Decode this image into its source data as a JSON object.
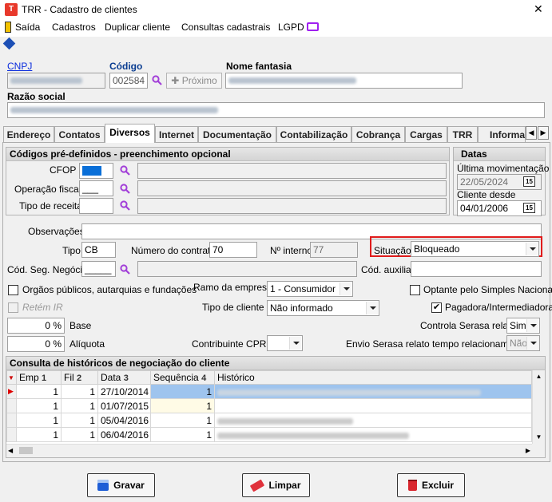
{
  "window": {
    "title": "TRR - Cadastro de clientes",
    "close_glyph": "✕"
  },
  "menu": {
    "saida": "Saída",
    "cadastros": "Cadastros",
    "duplicar": "Duplicar cliente",
    "consultas": "Consultas cadastrais",
    "lgpd": "LGPD"
  },
  "header": {
    "cnpj_label": "CNPJ",
    "codigo_label": "Código",
    "codigo_value": "002584",
    "proximo_label": "Próximo",
    "fantasia_label": "Nome fantasia",
    "razao_label": "Razão social"
  },
  "tabs": [
    "Endereço",
    "Contatos",
    "Diversos",
    "Internet",
    "Documentação",
    "Contabilização",
    "Cobrança",
    "Cargas",
    "TRR",
    "Informa"
  ],
  "codigos": {
    "title": "Códigos pré-definidos - preenchimento opcional",
    "cfop_label": "CFOP",
    "operacao_label": "Operação fiscal",
    "operacao_value": "___",
    "receita_label": "Tipo de receita"
  },
  "datas": {
    "title": "Datas",
    "ultima_label": "Última movimentação",
    "ultima_value": "22/05/2024",
    "cliente_desde_label": "Cliente desde",
    "cliente_desde_value": "04/01/2006",
    "cal_glyph": "15"
  },
  "form": {
    "observacoes_label": "Observações",
    "tipo_label": "Tipo",
    "tipo_value": "CB",
    "contrato_label": "Número do contrato",
    "contrato_value": "70",
    "interno_label": "Nº interno",
    "interno_value": "77",
    "situacao_label": "Situação",
    "situacao_value": "Bloqueado",
    "seg_negocio_label": "Cód. Seg. Negócio",
    "seg_negocio_value": "_____",
    "auxiliar_label": "Cód. auxiliar",
    "orgaos_label": "Orgãos públicos, autarquias e fundações",
    "ramo_label": "Ramo da empresa",
    "ramo_value": "1 - Consumidor",
    "simples_label": "Optante pelo Simples Nacional",
    "retem_label": "Retém IR",
    "tipo_cliente_label": "Tipo de cliente",
    "tipo_cliente_value": "Não informado",
    "pagadora_label": "Pagadora/Intermediadora",
    "base_value": "0 %",
    "base_label": "Base",
    "serasa_label": "Controla Serasa relato",
    "serasa_value": "Sim",
    "aliquota_value": "0 %",
    "aliquota_label": "Alíquota",
    "cprb_label": "Contribuinte CPRB",
    "envio_label": "Envio Serasa relato tempo relacionamento",
    "envio_value": "Não"
  },
  "historico": {
    "title": "Consulta de históricos de negociação do cliente",
    "columns": [
      "Emp",
      "Fil",
      "Data",
      "Sequência",
      "Histórico"
    ],
    "sort_badges": [
      "1",
      "2",
      "3",
      "4"
    ],
    "rows": [
      {
        "emp": "1",
        "fil": "1",
        "data": "27/10/2014",
        "seq": "1"
      },
      {
        "emp": "1",
        "fil": "1",
        "data": "01/07/2015",
        "seq": "1"
      },
      {
        "emp": "1",
        "fil": "1",
        "data": "05/04/2016",
        "seq": "1"
      },
      {
        "emp": "1",
        "fil": "1",
        "data": "06/04/2016",
        "seq": "1"
      }
    ]
  },
  "buttons": {
    "gravar": "Gravar",
    "limpar": "Limpar",
    "excluir": "Excluir"
  },
  "colors": {
    "highlight_border": "#e01b1b",
    "selected_row": "#9ec4ee",
    "accent": "#0a3d91"
  }
}
